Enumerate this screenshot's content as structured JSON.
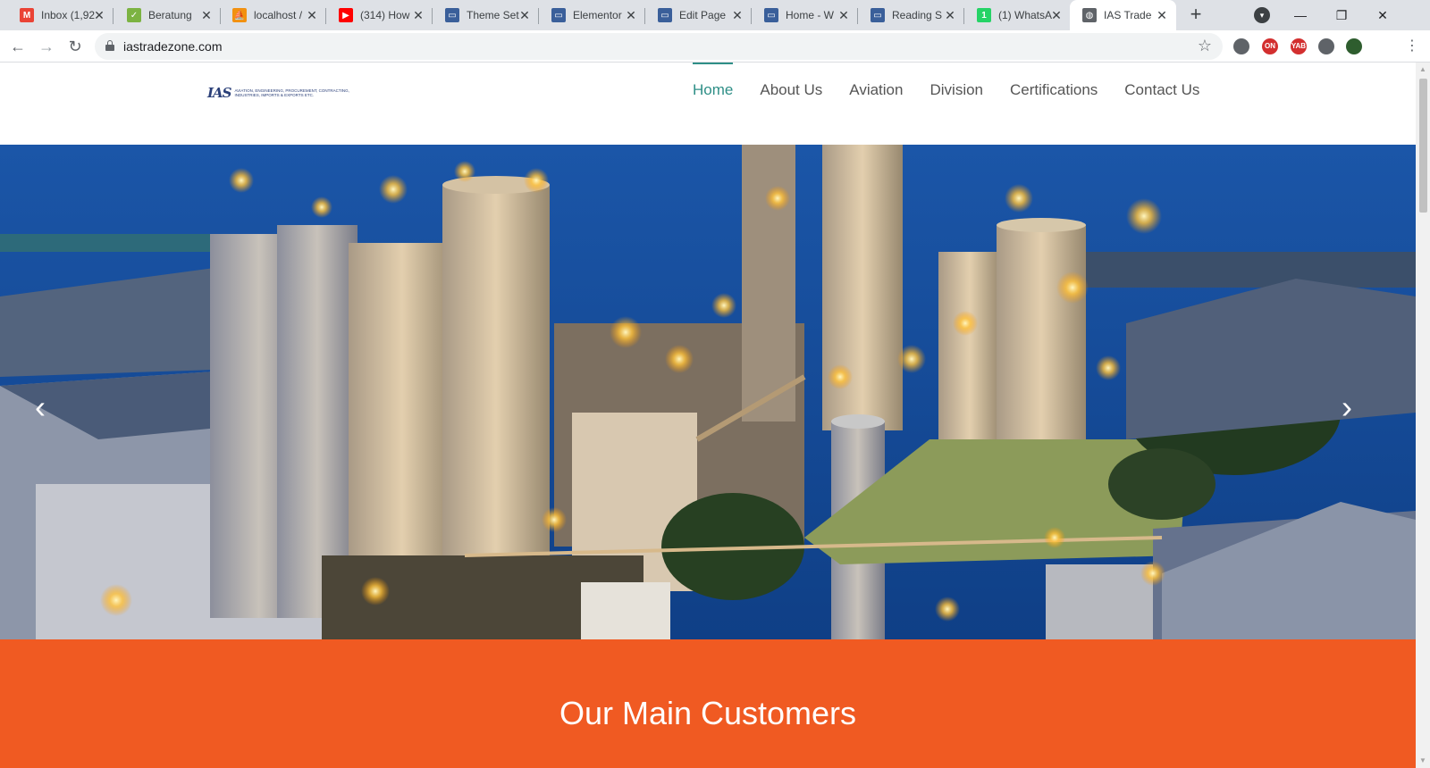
{
  "browser": {
    "tabs": [
      {
        "title": "Inbox (1,92",
        "icon": "gmail-icon",
        "color": "#ea4335",
        "glyph": "M"
      },
      {
        "title": "Beratung",
        "icon": "leaf-icon",
        "color": "#7cb342",
        "glyph": "✓"
      },
      {
        "title": "localhost /",
        "icon": "phpmyadmin-icon",
        "color": "#f29111",
        "glyph": "⛵"
      },
      {
        "title": "(314) How",
        "icon": "youtube-icon",
        "color": "#ff0000",
        "glyph": "▶"
      },
      {
        "title": "Theme Set",
        "icon": "laptop-icon",
        "color": "#3a5f9a",
        "glyph": "▭"
      },
      {
        "title": "Elementor",
        "icon": "laptop-icon",
        "color": "#3a5f9a",
        "glyph": "▭"
      },
      {
        "title": "Edit Page",
        "icon": "laptop-icon",
        "color": "#3a5f9a",
        "glyph": "▭"
      },
      {
        "title": "Home - W",
        "icon": "laptop-icon",
        "color": "#3a5f9a",
        "glyph": "▭"
      },
      {
        "title": "Reading S",
        "icon": "laptop-icon",
        "color": "#3a5f9a",
        "glyph": "▭"
      },
      {
        "title": "(1) WhatsA",
        "icon": "whatsapp-icon",
        "color": "#25d366",
        "glyph": "1"
      },
      {
        "title": "IAS Trade",
        "icon": "globe-icon",
        "color": "#5f6368",
        "glyph": "◍"
      }
    ],
    "active_tab": 10,
    "url": "iastradezone.com",
    "extensions": [
      {
        "icon": "cloud-extension-icon",
        "label": "",
        "color": "#5f6368"
      },
      {
        "icon": "zotero-extension-icon",
        "label": "ON",
        "color": "#d32f2f"
      },
      {
        "icon": "yab-extension-icon",
        "label": "YAB",
        "color": "#d32f2f"
      },
      {
        "icon": "puzzle-extension-icon",
        "label": "",
        "color": "#5f6368"
      },
      {
        "icon": "profile-avatar-icon",
        "label": "",
        "color": "#2e5d2e"
      }
    ]
  },
  "site": {
    "logo": {
      "mark": "IAS",
      "tagline": "AVIATION, ENGINEERING, PROCUREMENT, CONTRACTING, INDUSTRIES, IMPORTS & EXPORTS ETC."
    },
    "nav": [
      {
        "label": "Home",
        "active": true
      },
      {
        "label": "About Us",
        "active": false
      },
      {
        "label": "Aviation",
        "active": false
      },
      {
        "label": "Division",
        "active": false
      },
      {
        "label": "Certifications",
        "active": false
      },
      {
        "label": "Contact Us",
        "active": false
      }
    ],
    "hero": {
      "prev": "‹",
      "next": "›"
    },
    "customers": {
      "heading": "Our Main Customers"
    }
  },
  "colors": {
    "accent": "#2f8f87",
    "customers_bg": "#f05a22",
    "nav_text": "#555555"
  }
}
